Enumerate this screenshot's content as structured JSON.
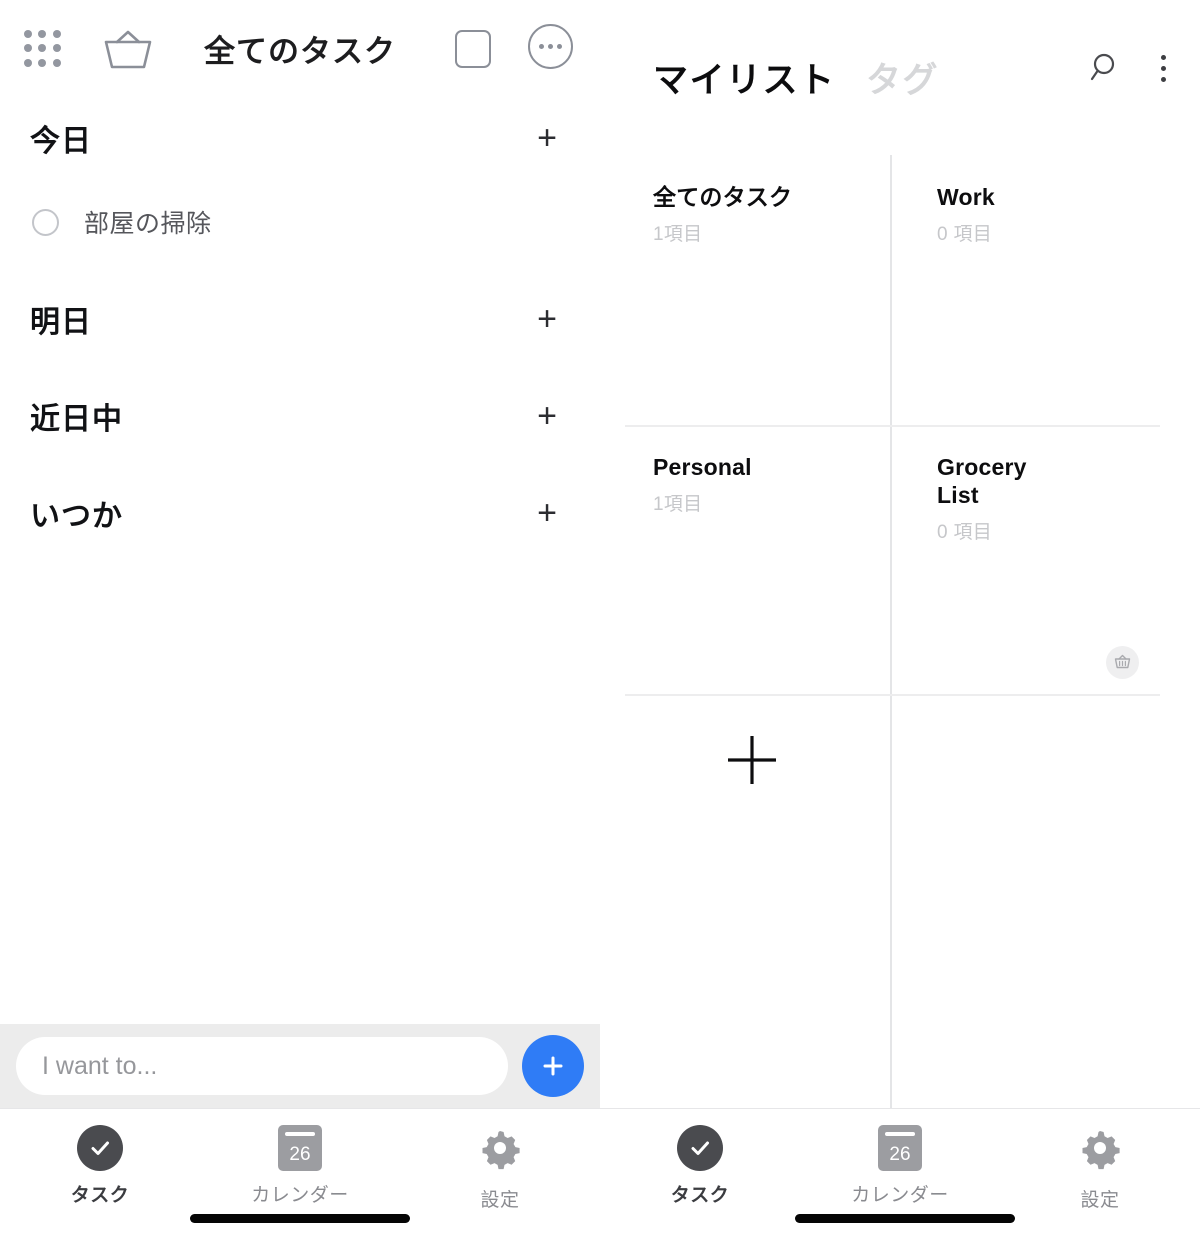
{
  "left_panel": {
    "header": {
      "title": "全てのタスク",
      "grid_icon": "grid-dots-icon",
      "basket_icon": "basket-icon",
      "square_icon": "square-outline-icon",
      "more_icon": "more-circle-icon"
    },
    "sections": [
      {
        "title": "今日",
        "add_label": "+"
      },
      {
        "title": "明日",
        "add_label": "+"
      },
      {
        "title": "近日中",
        "add_label": "+"
      },
      {
        "title": "いつか",
        "add_label": "+"
      }
    ],
    "tasks": [
      {
        "label": "部屋の掃除",
        "section": "今日",
        "completed": false
      }
    ],
    "input_bar": {
      "placeholder": "I want to...",
      "value": "",
      "add_button_label": "+",
      "add_button_color": "#2f7cf6",
      "background_color": "#ececec"
    }
  },
  "right_panel": {
    "header": {
      "tab_active": "マイリスト",
      "tab_inactive": "タグ",
      "search_icon": "search-icon",
      "menu_icon": "kebab-menu-icon"
    },
    "lists": [
      {
        "name": "全てのタスク",
        "count": "1項目",
        "badge": null
      },
      {
        "name": "Work",
        "count": "0 項目",
        "badge": null
      },
      {
        "name": "Personal",
        "count": "1項目",
        "badge": null
      },
      {
        "name": "Grocery List",
        "count": "0 項目",
        "badge": "basket-icon"
      }
    ],
    "add_list_label": "+"
  },
  "navbar": {
    "items": [
      {
        "label": "タスク",
        "icon": "check-circle-icon",
        "active": true
      },
      {
        "label": "カレンダー",
        "icon": "calendar-icon",
        "day": "26",
        "active": false
      },
      {
        "label": "設定",
        "icon": "gear-icon",
        "active": false
      }
    ]
  },
  "colors": {
    "accent_blue": "#2f7cf6",
    "text_primary": "#111215",
    "text_muted": "#c6c7ca",
    "icon_gray": "#8b8f98",
    "divider": "#e4e5e7"
  }
}
